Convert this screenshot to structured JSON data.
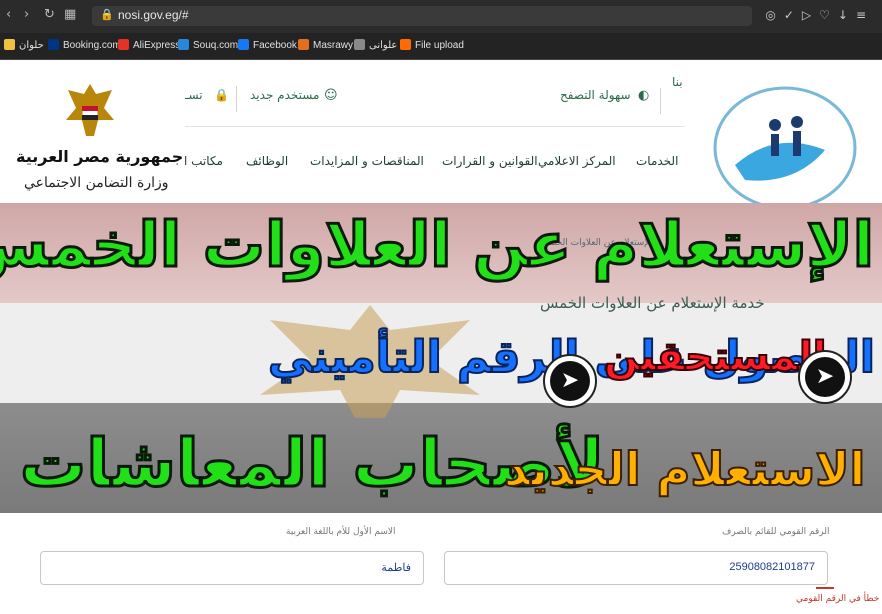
{
  "browser": {
    "url": "nosi.gov.eg/#",
    "bookmarks": [
      {
        "label": "حلوان",
        "icon": "folder-icon",
        "color": "#f0c040"
      },
      {
        "label": "Booking.com",
        "icon": "booking-icon",
        "color": "#003580"
      },
      {
        "label": "AliExpress",
        "icon": "aliexpress-icon",
        "color": "#e43225"
      },
      {
        "label": "Souq.com",
        "icon": "souq-icon",
        "color": "#2a86d8"
      },
      {
        "label": "Facebook",
        "icon": "facebook-icon",
        "color": "#1877f2"
      },
      {
        "label": "Masrawy",
        "icon": "masrawy-icon",
        "color": "#e07020"
      },
      {
        "label": "علوانى",
        "icon": "image-icon",
        "color": "#888888"
      },
      {
        "label": "File upload",
        "icon": "fileupload-icon",
        "color": "#ff6b00"
      }
    ]
  },
  "site": {
    "top_links": {
      "contact": "بنا",
      "accessibility": "سهولة التصفح",
      "new_user": "مستخدم جديد",
      "login": "تسـ"
    },
    "menu": [
      "الخدمات",
      "المركز الاعلامي",
      "القوانين و القرارات",
      "المناقصات و المزايدات",
      "الوظائف",
      "مكاتب ا"
    ],
    "gov_name": "جمهورية مصر العربية",
    "ministry": "وزارة التضامن الاجتماعي",
    "breadcrumb": "الإستعلام عن العلاوات الخمس",
    "service_title": "خدمة الإستعلام عن العلاوات الخمس"
  },
  "overlay": {
    "line1": "الإستعلام عن العلاوات الخمس",
    "line2a": "المستحقين",
    "line2b": "الحصول على الرقم التأميني",
    "line3a": "رابط الاستعلام الجديد",
    "line3b": "لأصحاب المعاشات"
  },
  "form": {
    "national_id_label": "الرقم القومي للقائم بالصرف",
    "national_id_value": "25908082101877",
    "first_name_label": "الاسم الأول للأم باللغة العربية",
    "first_name_value": "فاطمة",
    "error_text": "خطأ في الرقم القومي"
  }
}
